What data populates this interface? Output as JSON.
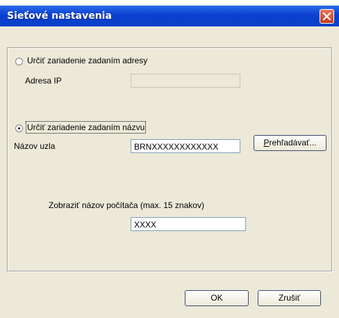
{
  "window": {
    "title": "Sieťové nastavenia"
  },
  "address_option": {
    "label": "Určiť zariadenie zadaním adresy",
    "selected": false
  },
  "ip_field": {
    "label": "Adresa IP",
    "value": ""
  },
  "name_option": {
    "label": "Určiť zariadenie zadaním názvu",
    "selected": true
  },
  "node_field": {
    "label": "Názov uzla",
    "value": "BRNXXXXXXXXXXXX"
  },
  "browse_button": {
    "label": "Prehľadávať...",
    "access_key": "P",
    "rest": "rehľadávať..."
  },
  "computer_name": {
    "label": "Zobraziť názov počítača (max. 15 znakov)",
    "value": "XXXX"
  },
  "buttons": {
    "ok": "OK",
    "cancel": "Zrušiť"
  },
  "icons": {
    "close": "close-icon"
  },
  "colors": {
    "titlebar": "#0842c7",
    "close": "#d9461f",
    "dialog_bg": "#ece9d8"
  }
}
